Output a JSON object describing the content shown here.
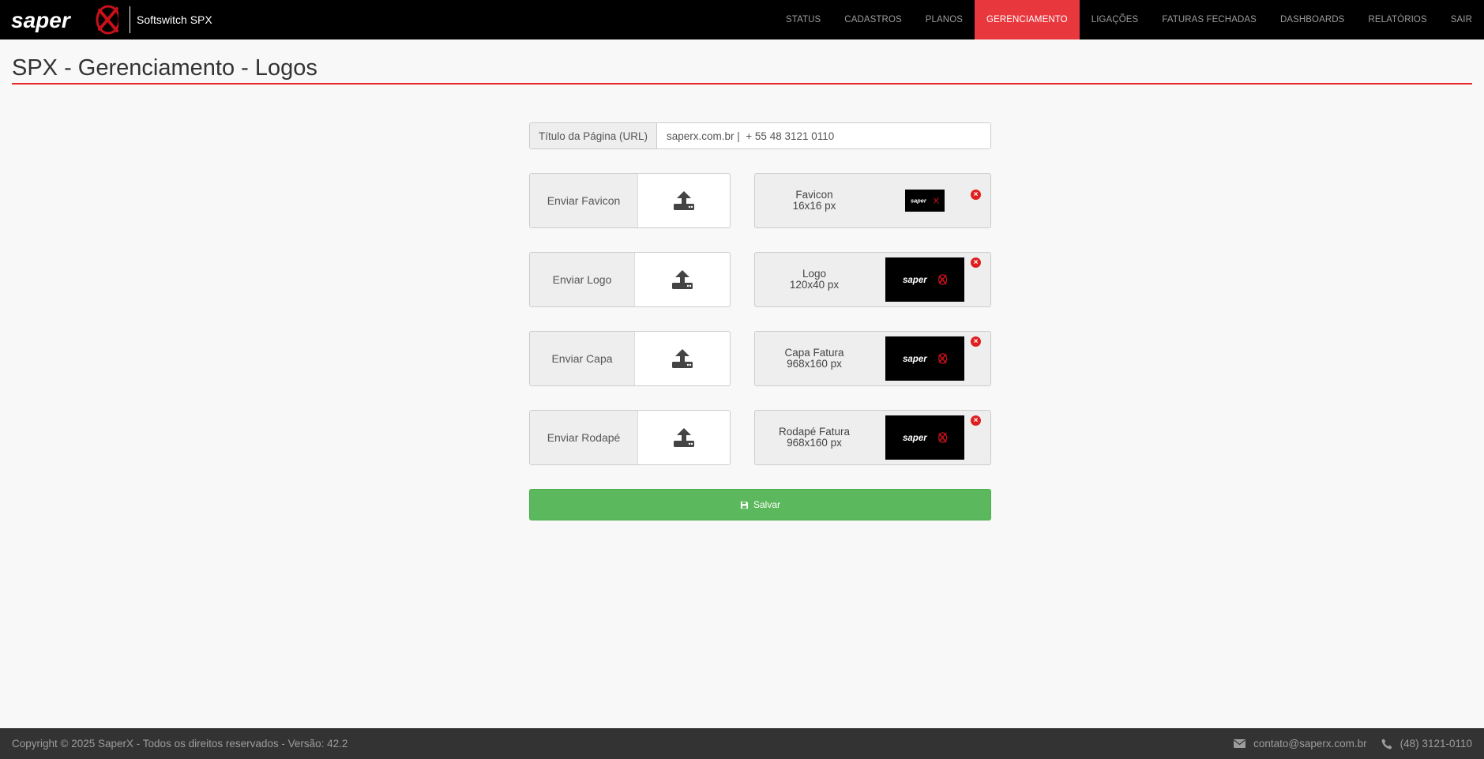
{
  "brand": {
    "logo_text": "saper",
    "logo_mark": "X",
    "app_name": "Softswitch SPX"
  },
  "nav": [
    {
      "label": "STATUS",
      "active": false
    },
    {
      "label": "CADASTROS",
      "active": false
    },
    {
      "label": "PLANOS",
      "active": false
    },
    {
      "label": "GERENCIAMENTO",
      "active": true
    },
    {
      "label": "LIGAÇÕES",
      "active": false
    },
    {
      "label": "FATURAS FECHADAS",
      "active": false
    },
    {
      "label": "DASHBOARDS",
      "active": false
    },
    {
      "label": "RELATÓRIOS",
      "active": false
    },
    {
      "label": "SAIR",
      "active": false
    }
  ],
  "page": {
    "title": "SPX - Gerenciamento - Logos"
  },
  "url_title": {
    "label": "Título da Página (URL)",
    "value": "saperx.com.br |  + 55 48 3121 0110"
  },
  "uploads": [
    {
      "label": "Enviar Favicon",
      "icon": "upload-icon"
    },
    {
      "label": "Enviar Logo",
      "icon": "upload-icon"
    },
    {
      "label": "Enviar Capa",
      "icon": "upload-icon"
    },
    {
      "label": "Enviar Rodapé",
      "icon": "upload-icon"
    }
  ],
  "previews": [
    {
      "name": "Favicon",
      "size": "16x16 px"
    },
    {
      "name": "Logo",
      "size": "120x40 px"
    },
    {
      "name": "Capa Fatura",
      "size": "968x160 px"
    },
    {
      "name": "Rodapé Fatura",
      "size": "968x160 px"
    }
  ],
  "save": {
    "label": "Salvar",
    "icon": "floppy-disk-icon"
  },
  "footer": {
    "copyright": "Copyright © 2025 SaperX - Todos os direitos reservados - Versão: 42.2",
    "email": "contato@saperx.com.br",
    "phone": "(48) 3121-0110"
  },
  "colors": {
    "accent": "#e8383d",
    "save": "#5cb85c",
    "navbar": "#000000",
    "footer": "#333333"
  }
}
